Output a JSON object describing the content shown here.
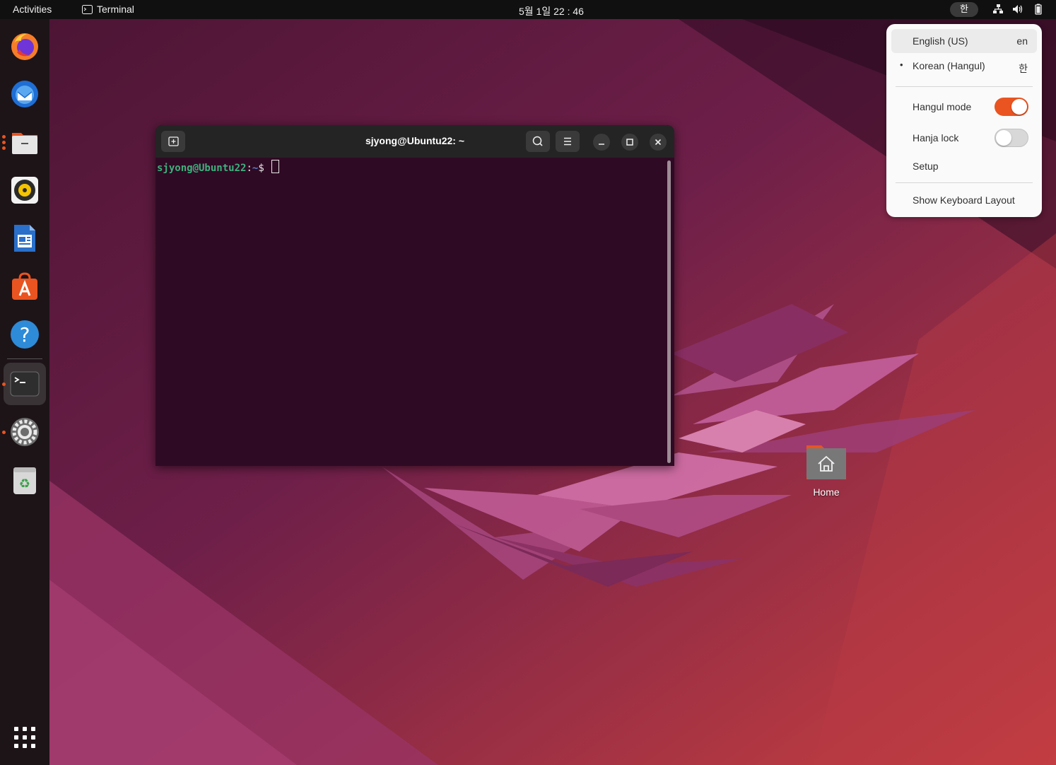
{
  "topbar": {
    "activities": "Activities",
    "app_name": "Terminal",
    "clock": "5월 1일  22 : 46",
    "ime_indicator": "한"
  },
  "dock": {
    "items": [
      "firefox-icon",
      "thunderbird-icon",
      "files-icon",
      "rhythmbox-icon",
      "libreoffice-writer-icon",
      "ubuntu-software-icon",
      "help-icon",
      "terminal-icon",
      "settings-icon",
      "trash-icon"
    ],
    "show_apps": "show-applications-icon"
  },
  "terminal": {
    "title": "sjyong@Ubuntu22: ~",
    "prompt_user": "sjyong@Ubuntu22",
    "prompt_colon": ":",
    "prompt_path": "~",
    "prompt_symbol": "$ "
  },
  "desktop": {
    "home_label": "Home"
  },
  "input_menu": {
    "sources": [
      {
        "label": "English (US)",
        "short": "en"
      },
      {
        "label": "Korean (Hangul)",
        "short": "한"
      }
    ],
    "hangul_mode": {
      "label": "Hangul mode",
      "on": true
    },
    "hanja_lock": {
      "label": "Hanja lock",
      "on": false
    },
    "setup": "Setup",
    "show_layout": "Show Keyboard Layout"
  },
  "colors": {
    "accent": "#e95420",
    "terminal_bg": "#2f0a24",
    "prompt_user": "#3fb07d",
    "prompt_path": "#5a7fc7"
  }
}
